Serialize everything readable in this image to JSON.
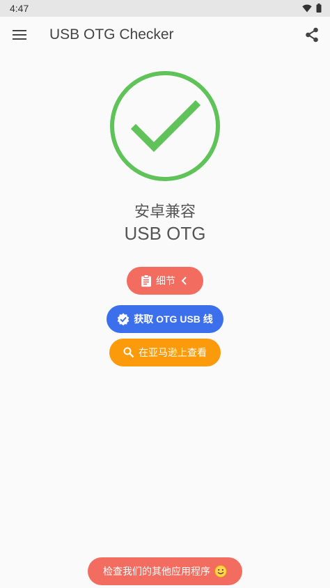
{
  "status_bar": {
    "time": "4:47",
    "icons": [
      "wifi-icon",
      "battery-icon"
    ]
  },
  "app_bar": {
    "title": "USB OTG Checker",
    "menu_icon": "menu-icon",
    "share_icon": "share-icon"
  },
  "result": {
    "icon": "check-circle-icon",
    "color": "#5fc35a",
    "line1": "安卓兼容",
    "line2": "USB OTG"
  },
  "buttons": {
    "details_label": "细节",
    "details_color": "#f26c5f",
    "get_cable_label": "获取 OTG USB 线",
    "get_cable_color": "#3c6fec",
    "amazon_label": "在亚马逊上查看",
    "amazon_color": "#fb9b0c",
    "other_apps_label": "检查我们的其他应用程序",
    "other_apps_color": "#f26c5f"
  }
}
